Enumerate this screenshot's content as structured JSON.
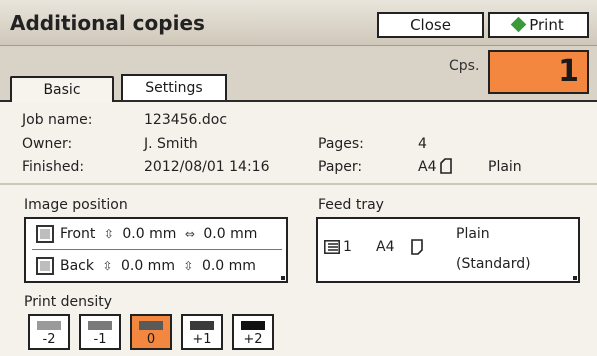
{
  "title": "Additional copies",
  "buttons": {
    "close": "Close",
    "print": "Print"
  },
  "tabs": {
    "basic": "Basic",
    "settings": "Settings"
  },
  "copies": {
    "label": "Cps.",
    "value": "1"
  },
  "job": {
    "job_name_label": "Job name:",
    "job_name": "123456.doc",
    "owner_label": "Owner:",
    "owner": "J. Smith",
    "finished_label": "Finished:",
    "finished": "2012/08/01 14:16",
    "pages_label": "Pages:",
    "pages": "4",
    "paper_label": "Paper:",
    "paper_size": "A4",
    "paper_type": "Plain"
  },
  "image_position": {
    "label": "Image position",
    "front": {
      "label": "Front",
      "v": "0.0 mm",
      "h": "0.0 mm"
    },
    "back": {
      "label": "Back",
      "v": "0.0 mm",
      "h": "0.0 mm"
    }
  },
  "feed_tray": {
    "label": "Feed tray",
    "tray": "1",
    "size": "A4",
    "type_line1": "Plain",
    "type_line2": "(Standard)"
  },
  "print_density": {
    "label": "Print density",
    "levels": [
      "-2",
      "-1",
      "0",
      "+1",
      "+2"
    ],
    "selected": "0"
  },
  "colors": {
    "accent": "#f4873f",
    "print_icon": "#3a9a3a"
  }
}
